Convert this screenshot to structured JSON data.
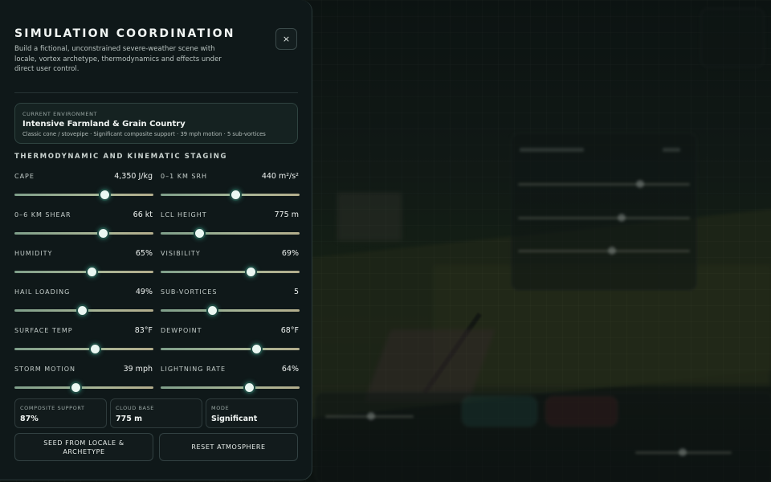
{
  "panel": {
    "title": "SIMULATION COORDINATION",
    "subtitle": "Build a fictional, unconstrained severe-weather scene with locale, vortex archetype, thermodynamics and effects under direct user control.",
    "close_label": "×"
  },
  "environment": {
    "caption": "CURRENT ENVIRONMENT",
    "name": "Intensive Farmland & Grain Country",
    "description": "Classic cone / stovepipe · Significant composite support · 39 mph motion · 5 sub-vortices"
  },
  "staging": {
    "title": "THERMODYNAMIC AND KINEMATIC STAGING",
    "params": [
      {
        "label": "CAPE",
        "value": "4,350 J/kg",
        "level": 0.65
      },
      {
        "label": "0–1 KM SRH",
        "value": "440 m²/s²",
        "level": 0.54
      },
      {
        "label": "0–6 KM SHEAR",
        "value": "66 kt",
        "level": 0.64
      },
      {
        "label": "LCL HEIGHT",
        "value": "775 m",
        "level": 0.28
      },
      {
        "label": "HUMIDITY",
        "value": "65%",
        "level": 0.56
      },
      {
        "label": "VISIBILITY",
        "value": "69%",
        "level": 0.65
      },
      {
        "label": "HAIL LOADING",
        "value": "49%",
        "level": 0.49
      },
      {
        "label": "SUB-VORTICES",
        "value": "5",
        "level": 0.37
      },
      {
        "label": "SURFACE TEMP",
        "value": "83°F",
        "level": 0.58
      },
      {
        "label": "DEWPOINT",
        "value": "68°F",
        "level": 0.69
      },
      {
        "label": "STORM MOTION",
        "value": "39 mph",
        "level": 0.44
      },
      {
        "label": "LIGHTNING RATE",
        "value": "64%",
        "level": 0.64
      }
    ]
  },
  "stats": [
    {
      "caption": "COMPOSITE SUPPORT",
      "value": "87%"
    },
    {
      "caption": "CLOUD BASE",
      "value": "775 m"
    },
    {
      "caption": "MODE",
      "value": "Significant"
    }
  ],
  "actions": {
    "seed_label": "SEED FROM LOCALE & ARCHETYPE",
    "reset_label": "RESET ATMOSPHERE"
  },
  "colors": {
    "panel_bg": "#0f1819",
    "accent": "#4fd2b4",
    "track_start": "#7f9f8a",
    "track_end": "#b3ad8c"
  }
}
